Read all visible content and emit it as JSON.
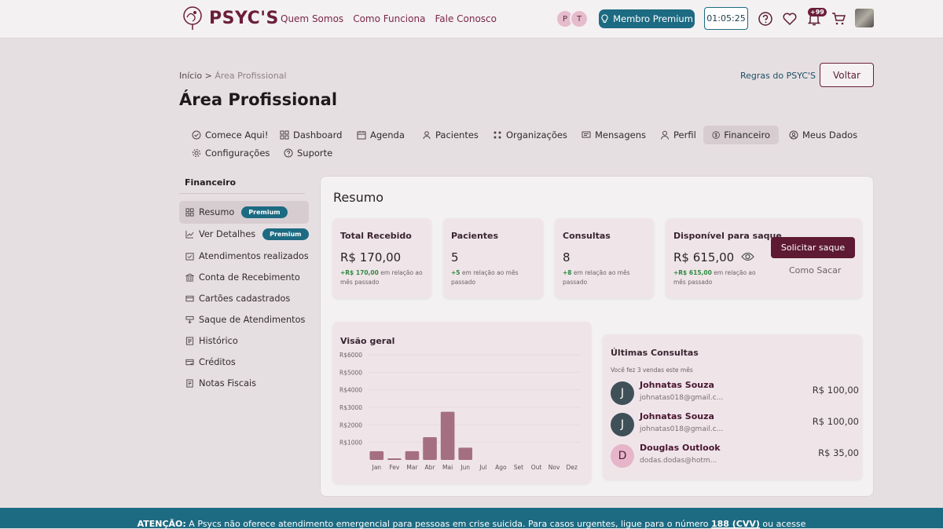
{
  "header": {
    "brand": "PSYC'S",
    "nav": [
      "Quem Somos",
      "Como Funciona",
      "Fale Conosco"
    ],
    "avatar_initials": [
      "P",
      "T"
    ],
    "premium_button": "Membro Premium",
    "timer": "01:05:25",
    "notification_badge": "+99"
  },
  "breadcrumb": {
    "home": "Início",
    "sep": " > ",
    "current": "Área Profissional"
  },
  "page_title": "Área Profissional",
  "rules_link": "Regras do PSYC'S",
  "back_button": "Voltar",
  "tabs": [
    {
      "label": "Comece Aqui!",
      "icon": "check-circle-icon"
    },
    {
      "label": "Dashboard",
      "icon": "grid-icon"
    },
    {
      "label": "Agenda",
      "icon": "calendar-icon"
    },
    {
      "label": "Pacientes",
      "icon": "user-icon"
    },
    {
      "label": "Organizações",
      "icon": "organization-icon"
    },
    {
      "label": "Mensagens",
      "icon": "message-icon"
    },
    {
      "label": "Perfil",
      "icon": "profile-icon"
    },
    {
      "label": "Financeiro",
      "icon": "dollar-circle-icon",
      "active": true
    },
    {
      "label": "Meus Dados",
      "icon": "user-circle-icon"
    },
    {
      "label": "Configurações",
      "icon": "gear-icon"
    },
    {
      "label": "Suporte",
      "icon": "help-icon"
    }
  ],
  "sidebar": {
    "title": "Financeiro",
    "items": [
      {
        "label": "Resumo",
        "badge": "Premium",
        "icon": "grid-icon",
        "active": true
      },
      {
        "label": "Ver Detalhes",
        "badge": "Premium",
        "icon": "chart-line-icon"
      },
      {
        "label": "Atendimentos realizados",
        "icon": "calendar-check-icon"
      },
      {
        "label": "Conta de Recebimento",
        "icon": "bank-icon"
      },
      {
        "label": "Cartões cadastrados",
        "icon": "card-icon"
      },
      {
        "label": "Saque de Atendimentos",
        "icon": "withdraw-icon"
      },
      {
        "label": "Histórico",
        "icon": "history-icon"
      },
      {
        "label": "Créditos",
        "icon": "credit-icon"
      },
      {
        "label": "Notas Fiscais",
        "icon": "invoice-icon"
      }
    ]
  },
  "summary": {
    "title": "Resumo",
    "cards": [
      {
        "label": "Total Recebido",
        "value": "R$ 170,00",
        "change": "+R$ 170,00",
        "note": " em relação ao mês passado"
      },
      {
        "label": "Pacientes",
        "value": "5",
        "change": "+5",
        "note": " em relação ao mês passado"
      },
      {
        "label": "Consultas",
        "value": "8",
        "change": "+8",
        "note": " em relação ao mês passado"
      },
      {
        "label": "Disponível para saque",
        "value": "R$ 615,00",
        "change": "+R$ 615,00",
        "note": " em relação ao mês passado"
      }
    ],
    "withdraw_button": "Solicitar saque",
    "how_link": "Como Sacar"
  },
  "chart_data": {
    "type": "bar",
    "title": "Visão geral",
    "categories": [
      "Jan",
      "Fev",
      "Mar",
      "Abr",
      "Mai",
      "Jun",
      "Jul",
      "Ago",
      "Set",
      "Out",
      "Nov",
      "Dez"
    ],
    "values": [
      500,
      60,
      500,
      1300,
      2750,
      700,
      0,
      0,
      0,
      0,
      0,
      0
    ],
    "yticks": [
      "R$1000",
      "R$2000",
      "R$3000",
      "R$4000",
      "R$5000",
      "R$6000"
    ],
    "ylim": [
      0,
      6000
    ],
    "bar_color": "#a56f82"
  },
  "recent": {
    "title": "Últimas Consultas",
    "subtitle": "Você fez 3 vendas este mês",
    "rows": [
      {
        "initial": "J",
        "name": "Johnatas Souza",
        "email": "johnatas018@gmail.c...",
        "amount": "R$ 100,00",
        "color": "#3f5058",
        "text_color": "#ffffff"
      },
      {
        "initial": "J",
        "name": "Johnatas Souza",
        "email": "johnatas018@gmail.c...",
        "amount": "R$ 100,00",
        "color": "#3f5058",
        "text_color": "#ffffff"
      },
      {
        "initial": "D",
        "name": "Douglas Outlook",
        "email": "dodas.dodas@hotm...",
        "amount": "R$ 35,00",
        "color": "#e6b5c9",
        "text_color": "#5a1f36"
      }
    ]
  },
  "footer": {
    "bold": "ATENÇÃO:",
    "text": " A Psycs não oferece atendimento emergencial para pessoas em crise suicida. Para casos urgentes, ligue para o número ",
    "phone": "188 (CVV)",
    "tail": " ou acesse"
  },
  "colors": {
    "brand": "#6b1e3a",
    "accent": "#1d6b82"
  }
}
